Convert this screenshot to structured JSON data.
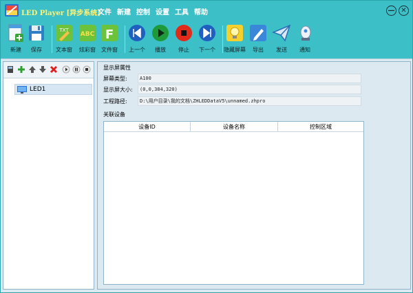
{
  "window": {
    "title": "LED Player [异步系统]",
    "minimize_symbol": "—",
    "close_symbol": "✕"
  },
  "menu": [
    "文件",
    "新建",
    "控制",
    "设置",
    "工具",
    "帮助"
  ],
  "toolbar": {
    "new": "新建",
    "save": "保存",
    "text_window": "文本窗",
    "colorful_window": "炫彩窗",
    "file_window": "文件窗",
    "prev": "上一个",
    "play": "播放",
    "stop": "停止",
    "next": "下一个",
    "hide_screen": "隐藏屏幕",
    "export": "导出",
    "send": "发送",
    "notify": "通知"
  },
  "tree": {
    "items": [
      {
        "label": "LED1"
      }
    ]
  },
  "display_props": {
    "section_title": "显示屏属性",
    "screen_type_label": "屏幕类型:",
    "screen_type_value": "A100",
    "screen_size_label": "显示屏大小:",
    "screen_size_value": "(0,0,384,320)",
    "project_path_label": "工程路径:",
    "project_path_value": "D:\\用户目录\\我的文档\\ZHLEDDataV5\\unnamed.zhpro"
  },
  "devices": {
    "section_title": "关联设备",
    "columns": [
      "设备ID",
      "设备名称",
      "控制区域"
    ],
    "rows": []
  },
  "colors": {
    "frame": "#3cbfc6",
    "panel_bg": "#dde9f1",
    "title_text": "#fff57a"
  }
}
